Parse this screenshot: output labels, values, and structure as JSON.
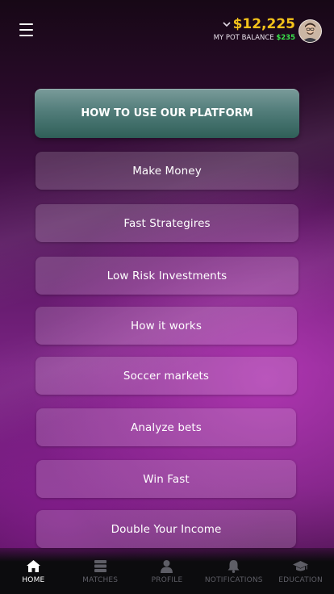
{
  "header": {
    "balance_amount": "$12,225",
    "pot_label": "MY POT BALANCE",
    "pot_value": "$235"
  },
  "main": {
    "primary_label": "HOW TO USE OUR PLATFORM",
    "items": [
      {
        "label": "Make Money"
      },
      {
        "label": "Fast Strategires"
      },
      {
        "label": "Low Risk Investments"
      },
      {
        "label": "How it works"
      },
      {
        "label": "Soccer markets"
      },
      {
        "label": "Analyze bets"
      },
      {
        "label": "Win Fast"
      },
      {
        "label": "Double Your Income"
      }
    ]
  },
  "nav": {
    "items": [
      {
        "label": "HOME",
        "icon": "home-icon",
        "active": true
      },
      {
        "label": "MATCHES",
        "icon": "matches-icon"
      },
      {
        "label": "PROFILE",
        "icon": "profile-icon"
      },
      {
        "label": "NOTIFICATIONS",
        "icon": "bell-icon"
      },
      {
        "label": "EDUCATION",
        "icon": "graduation-cap-icon"
      }
    ]
  },
  "colors": {
    "accent_gold": "#f4c21a",
    "pot_green": "#39e04a",
    "primary_button": "#527d7a"
  }
}
